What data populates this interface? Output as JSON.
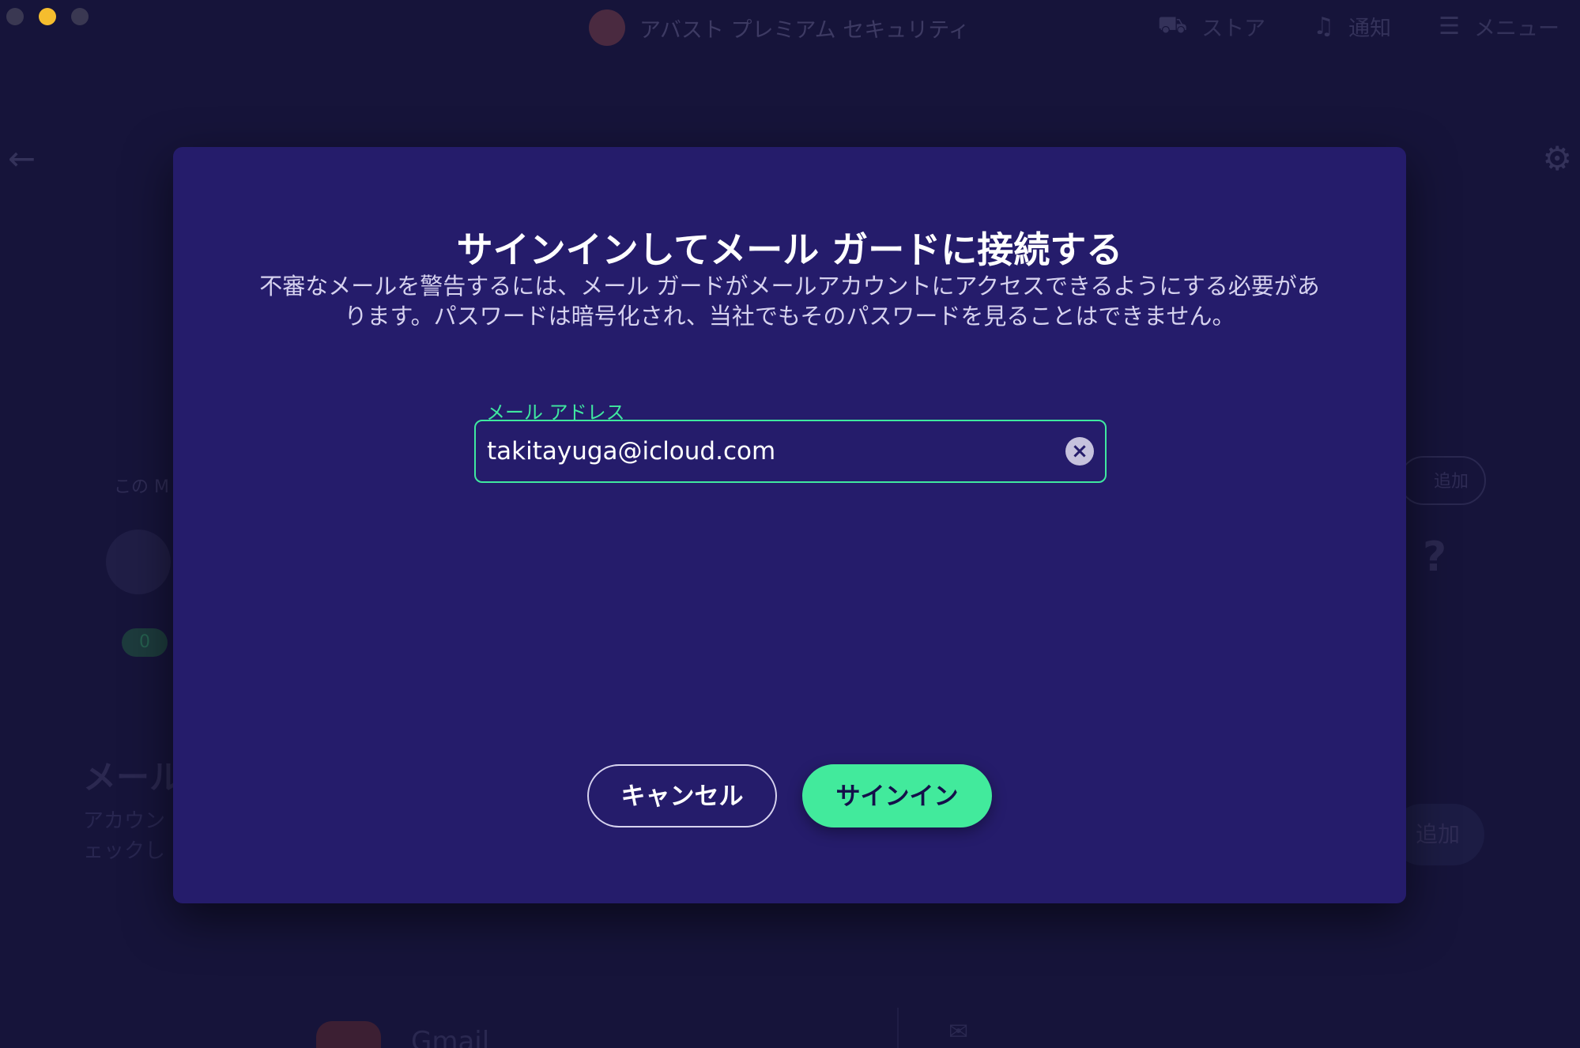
{
  "window": {
    "app_title": "アバスト プレミアム セキュリティ",
    "nav": {
      "store": "ストア",
      "notifications": "通知",
      "menu": "メニュー"
    }
  },
  "background": {
    "small_label": "この M",
    "counter": "0",
    "add_outline": "追加",
    "section_title": "メール",
    "section_desc_1": "アカウン",
    "section_desc_2": "ェックし",
    "add_fill": "追加",
    "gmail": "Gmail"
  },
  "dialog": {
    "title": "サインインしてメール ガードに接続する",
    "description": "不審なメールを警告するには、メール ガードがメールアカウントにアクセスできるようにする必要があります。パスワードは暗号化され、当社でもそのパスワードを見ることはできません。",
    "email_label": "メール アドレス",
    "email_value": "takitayuga@icloud.com",
    "cancel_label": "キャンセル",
    "signin_label": "サインイン"
  },
  "colors": {
    "accent": "#42ea9c",
    "modal_bg": "#251c6b",
    "window_bg": "#16143a"
  }
}
